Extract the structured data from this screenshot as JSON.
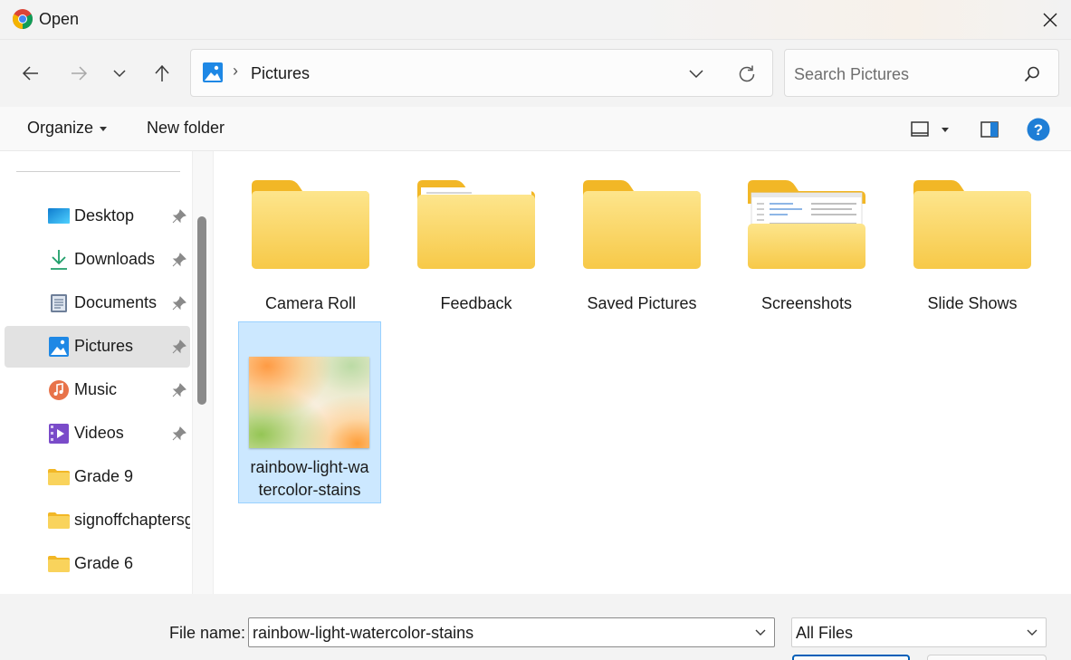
{
  "window": {
    "title": "Open",
    "app_icon": "chrome-icon"
  },
  "navigation": {
    "back_icon": "arrow-left-icon",
    "forward_icon": "arrow-right-icon",
    "recent_icon": "chevron-down-icon",
    "up_icon": "arrow-up-icon",
    "address": {
      "icon": "pictures-icon",
      "separator": "›",
      "path": "Pictures"
    },
    "refresh_icon": "refresh-icon",
    "search": {
      "placeholder": "Search Pictures",
      "value": ""
    }
  },
  "toolbar": {
    "organize_label": "Organize",
    "new_folder_label": "New folder",
    "view_icon": "view-pane-icon",
    "preview_pane_icon": "preview-pane-icon",
    "help_icon": "help-icon"
  },
  "sidebar": {
    "items": [
      {
        "label": "Desktop",
        "icon": "desktop-icon",
        "pinned": true,
        "selected": false
      },
      {
        "label": "Downloads",
        "icon": "download-icon",
        "pinned": true,
        "selected": false
      },
      {
        "label": "Documents",
        "icon": "documents-icon",
        "pinned": true,
        "selected": false
      },
      {
        "label": "Pictures",
        "icon": "pictures-icon",
        "pinned": true,
        "selected": true
      },
      {
        "label": "Music",
        "icon": "music-icon",
        "pinned": true,
        "selected": false
      },
      {
        "label": "Videos",
        "icon": "videos-icon",
        "pinned": true,
        "selected": false
      },
      {
        "label": "Grade 9",
        "icon": "folder-icon",
        "pinned": false,
        "selected": false
      },
      {
        "label": "signoffchaptersg",
        "icon": "folder-icon",
        "pinned": false,
        "selected": false
      },
      {
        "label": "Grade 6",
        "icon": "folder-icon",
        "pinned": false,
        "selected": false
      }
    ]
  },
  "content": {
    "folders": [
      {
        "label": "Camera Roll",
        "variant": "empty"
      },
      {
        "label": "Feedback",
        "variant": "with-paper"
      },
      {
        "label": "Saved Pictures",
        "variant": "empty"
      },
      {
        "label": "Screenshots",
        "variant": "with-screenshot"
      },
      {
        "label": "Slide Shows",
        "variant": "empty"
      }
    ],
    "files": [
      {
        "label_line1": "rainbow-light-wa",
        "label_line2": "tercolor-stains",
        "selected": true
      }
    ]
  },
  "footer": {
    "file_name_label": "File name:",
    "file_name_value": "rainbow-light-watercolor-stains",
    "file_type": "All Files"
  },
  "colors": {
    "accent": "#005fb8",
    "folder_yellow": "#f9d35c",
    "folder_tab": "#f2b726",
    "selection_bg": "#cce8ff",
    "help_blue": "#1f7ed6"
  }
}
